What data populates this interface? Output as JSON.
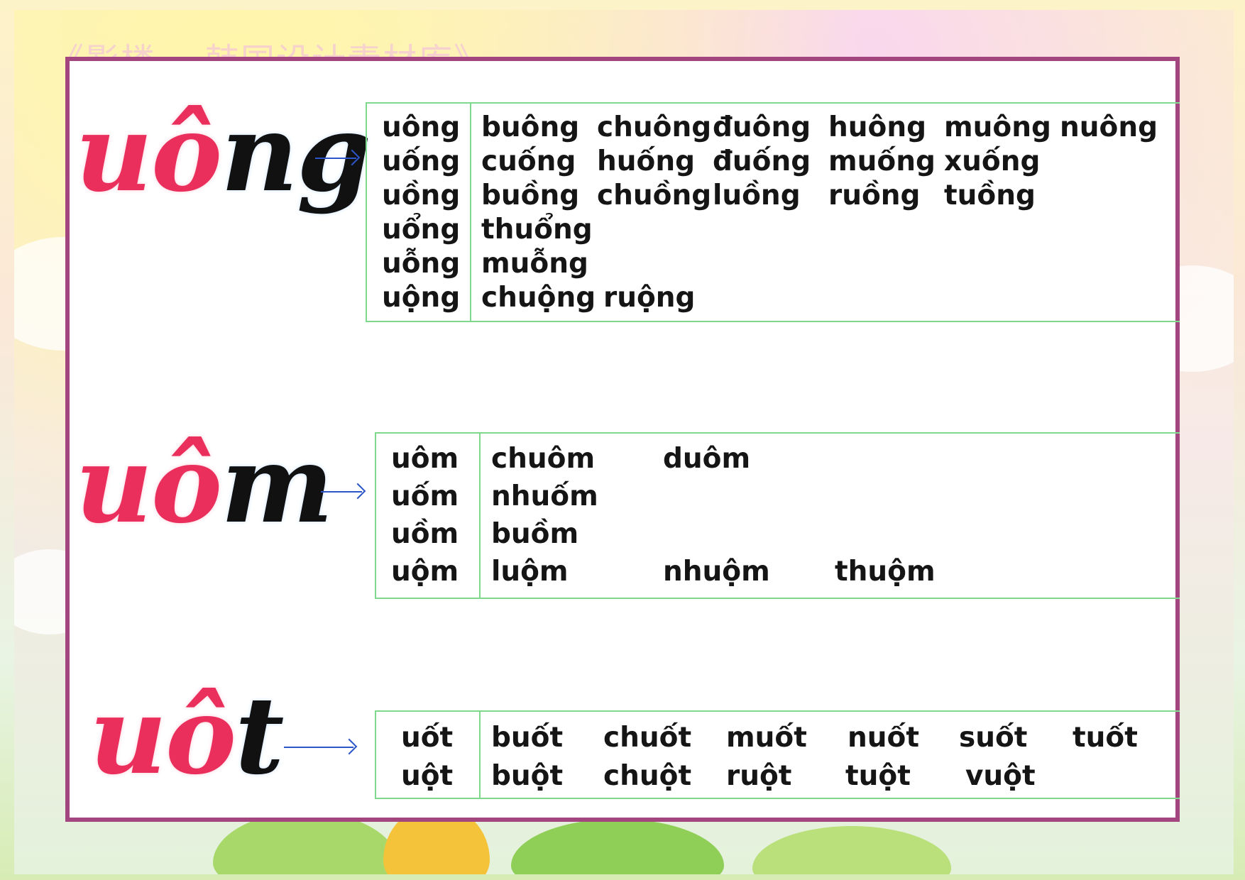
{
  "watermark": "《影楼... 韩国设计素材库》",
  "sections": {
    "uong": {
      "title_pink": "uô",
      "title_black": "ng",
      "rows": [
        {
          "base": "uông",
          "words": [
            "buông",
            "chuông",
            "đuông",
            "huông",
            "muông",
            "nuông"
          ]
        },
        {
          "base": "uống",
          "words": [
            "cuống",
            "huống",
            "đuống",
            "muống",
            "xuống"
          ]
        },
        {
          "base": "uồng",
          "words": [
            "buồng",
            "chuồng",
            "luồng",
            "ruồng",
            "tuồng"
          ]
        },
        {
          "base": "uổng",
          "words": [
            "thuổng"
          ]
        },
        {
          "base": "uỗng",
          "words": [
            "muỗng"
          ]
        },
        {
          "base": "uộng",
          "words": [
            "chuộng",
            "ruộng"
          ]
        }
      ]
    },
    "uom": {
      "title_pink": "uô",
      "title_black": "m",
      "rows": [
        {
          "base": "uôm",
          "words": [
            "chuôm",
            "duôm"
          ]
        },
        {
          "base": "uốm",
          "words": [
            "nhuốm"
          ]
        },
        {
          "base": "uồm",
          "words": [
            "buồm"
          ]
        },
        {
          "base": "uộm",
          "words": [
            "luộm",
            "nhuộm",
            "thuộm"
          ]
        }
      ]
    },
    "uot": {
      "title_pink": "uô",
      "title_black": "t",
      "rows": [
        {
          "base": "uốt",
          "words": [
            "buốt",
            "chuốt",
            "muốt",
            "nuốt",
            "suốt",
            "tuốt"
          ]
        },
        {
          "base": "uột",
          "words": [
            "buột",
            "chuột",
            "ruột",
            "tuột",
            "vuột"
          ]
        }
      ]
    }
  }
}
